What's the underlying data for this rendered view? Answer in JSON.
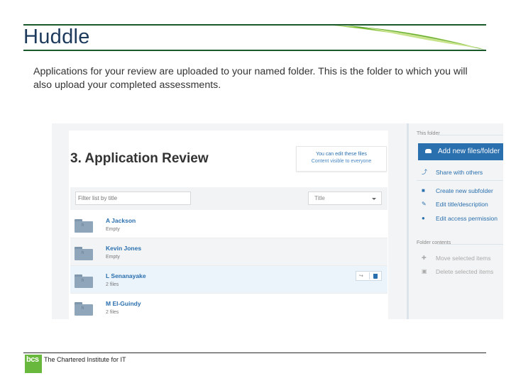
{
  "slide": {
    "title": "Huddle",
    "intro": "Applications for your review are uploaded to your named folder.  This is the folder to which you will also upload your completed assessments."
  },
  "app": {
    "heading": "3. Application Review",
    "edit_note_line1": "You can edit these files",
    "edit_note_line2": "Content visible to everyone",
    "filter_placeholder": "Filter list by title",
    "sort_label": "Title",
    "folders": [
      {
        "name": "A Jackson",
        "status": "Empty"
      },
      {
        "name": "Kevin Jones",
        "status": "Empty"
      },
      {
        "name": "L Senanayake",
        "status": "2 files"
      },
      {
        "name": "M El-Guindy",
        "status": "2 files"
      }
    ],
    "side_panel": {
      "section_folder": "This folder",
      "add_button": "Add new files/folder",
      "share": "Share with others",
      "create_subfolder": "Create new subfolder",
      "edit_title": "Edit title/description",
      "edit_access": "Edit access permission",
      "section_contents": "Folder contents",
      "move_items": "Move selected items",
      "delete_items": "Delete selected items"
    }
  },
  "footer": {
    "logo_text": "bcs",
    "caption": "The Chartered Institute for IT"
  },
  "colors": {
    "accent_blue": "#2a6fae",
    "brand_green": "#68b83d",
    "title_navy": "#1d3a5c"
  }
}
